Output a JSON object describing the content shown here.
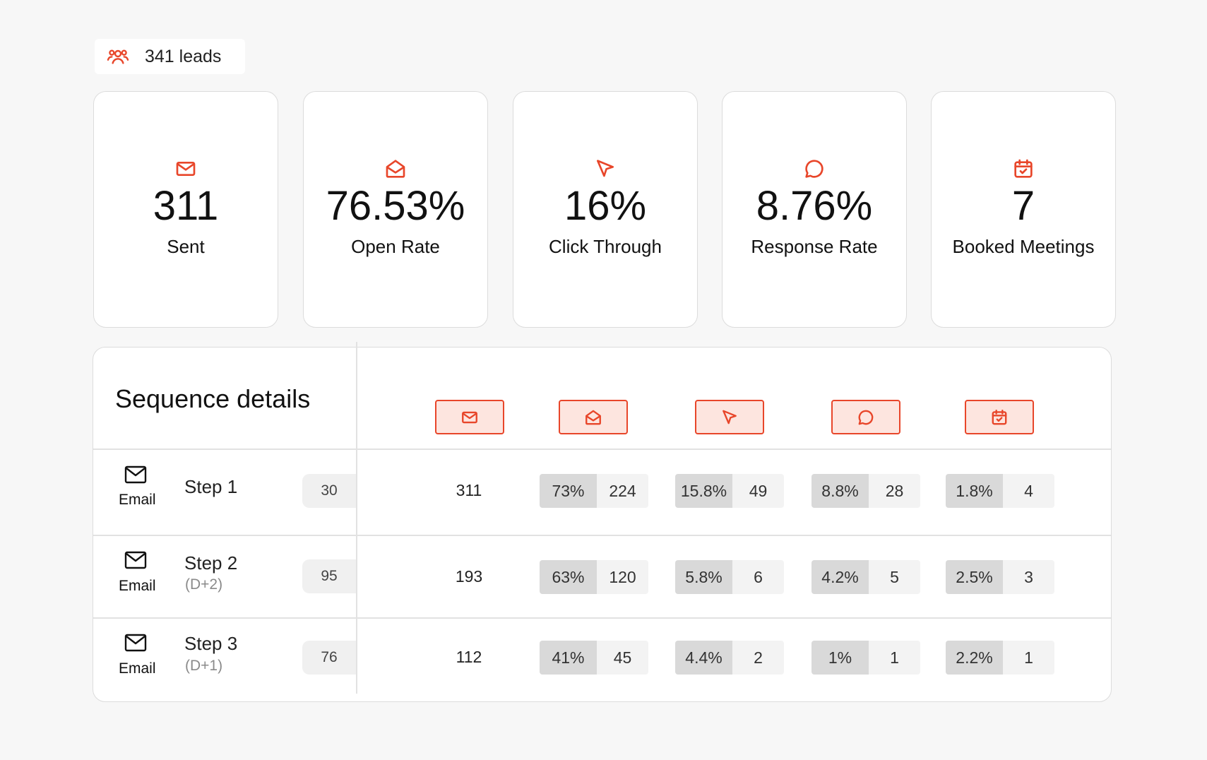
{
  "leads": {
    "label": "341 leads"
  },
  "accent_color": "#e8462a",
  "cards": [
    {
      "icon": "mail-icon",
      "value": "311",
      "label": "Sent"
    },
    {
      "icon": "mail-open-icon",
      "value": "76.53%",
      "label": "Open Rate"
    },
    {
      "icon": "cursor-icon",
      "value": "16%",
      "label": "Click Through"
    },
    {
      "icon": "chat-icon",
      "value": "8.76%",
      "label": "Response Rate"
    },
    {
      "icon": "calendar-check-icon",
      "value": "7",
      "label": "Booked Meetings"
    }
  ],
  "sequence": {
    "title": "Sequence details",
    "header_icons": [
      "mail-icon",
      "mail-open-icon",
      "cursor-icon",
      "chat-icon",
      "calendar-check-icon"
    ],
    "rows": [
      {
        "channel": "Email",
        "step": "Step 1",
        "delay": "",
        "count": "30",
        "sent": "311",
        "open": {
          "pct": "73%",
          "num": "224"
        },
        "click": {
          "pct": "15.8%",
          "num": "49"
        },
        "response": {
          "pct": "8.8%",
          "num": "28"
        },
        "booked": {
          "pct": "1.8%",
          "num": "4"
        }
      },
      {
        "channel": "Email",
        "step": "Step 2",
        "delay": "(D+2)",
        "count": "95",
        "sent": "193",
        "open": {
          "pct": "63%",
          "num": "120"
        },
        "click": {
          "pct": "5.8%",
          "num": "6"
        },
        "response": {
          "pct": "4.2%",
          "num": "5"
        },
        "booked": {
          "pct": "2.5%",
          "num": "3"
        }
      },
      {
        "channel": "Email",
        "step": "Step 3",
        "delay": "(D+1)",
        "count": "76",
        "sent": "112",
        "open": {
          "pct": "41%",
          "num": "45"
        },
        "click": {
          "pct": "4.4%",
          "num": "2"
        },
        "response": {
          "pct": "1%",
          "num": "1"
        },
        "booked": {
          "pct": "2.2%",
          "num": "1"
        }
      }
    ]
  }
}
